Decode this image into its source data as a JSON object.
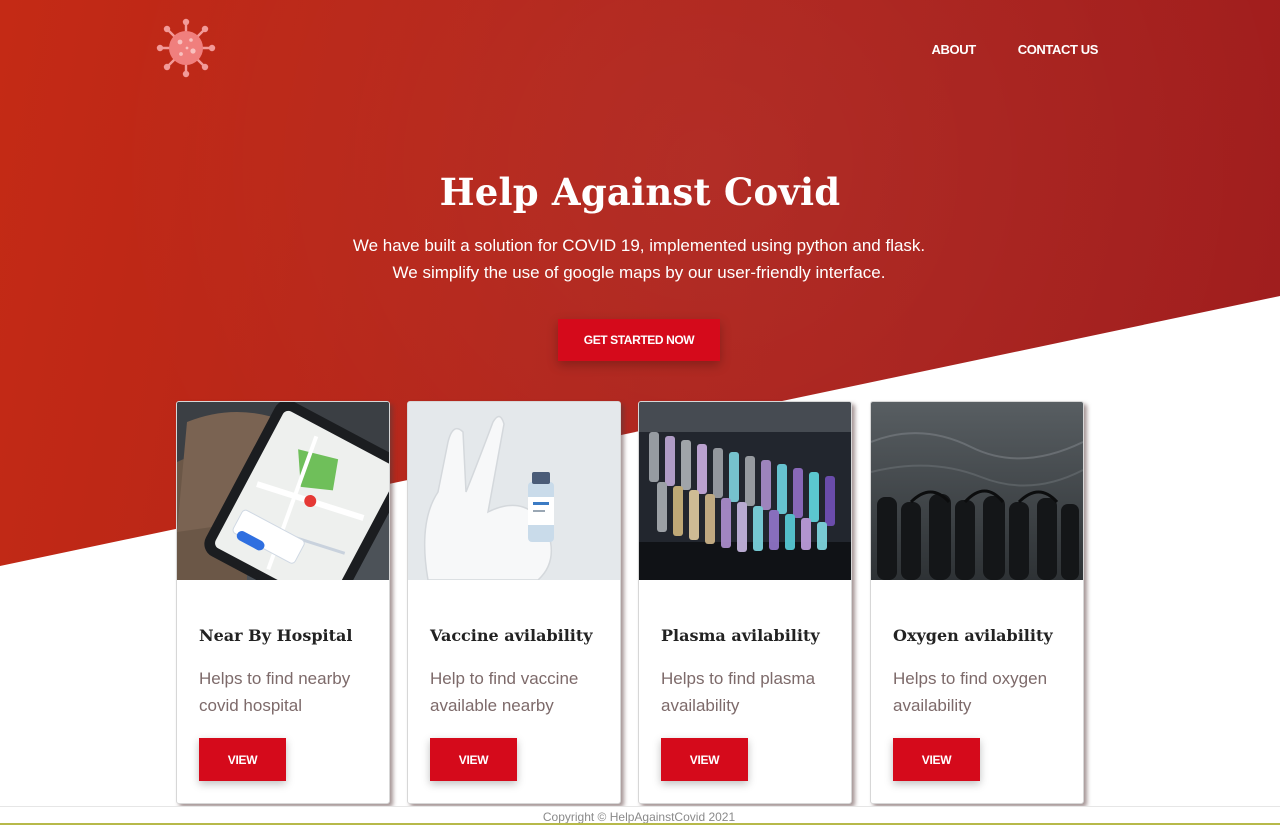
{
  "nav": {
    "items": [
      "ABOUT",
      "CONTACT US"
    ]
  },
  "hero": {
    "title": "Help Against Covid",
    "subtitle_line1": "We have built a solution for COVID 19, implemented using python and flask.",
    "subtitle_line2": "We simplify the use of google maps by our user-friendly interface.",
    "cta_label": "GET STARTED NOW"
  },
  "cards": [
    {
      "title": "Near By Hospital",
      "text": "Helps to find nearby covid hospital",
      "button": "VIEW",
      "image": "phone-map-photo"
    },
    {
      "title": "Vaccine avilability",
      "text": "Help to find vaccine available nearby",
      "button": "VIEW",
      "image": "gloved-hand-vaccine-vial-photo"
    },
    {
      "title": "Plasma avilability",
      "text": "Helps to find plasma availability",
      "button": "VIEW",
      "image": "blood-sample-tubes-photo"
    },
    {
      "title": "Oxygen avilability",
      "text": "Helps to find oxygen availability",
      "button": "VIEW",
      "image": "oxygen-tanks-photo"
    }
  ],
  "footer": {
    "copyright": "Copyright © HelpAgainstCovid 2021"
  },
  "colors": {
    "hero_red": "#b0231a",
    "button_red": "#d50a1b",
    "logo_pink": "#f08a8a"
  }
}
